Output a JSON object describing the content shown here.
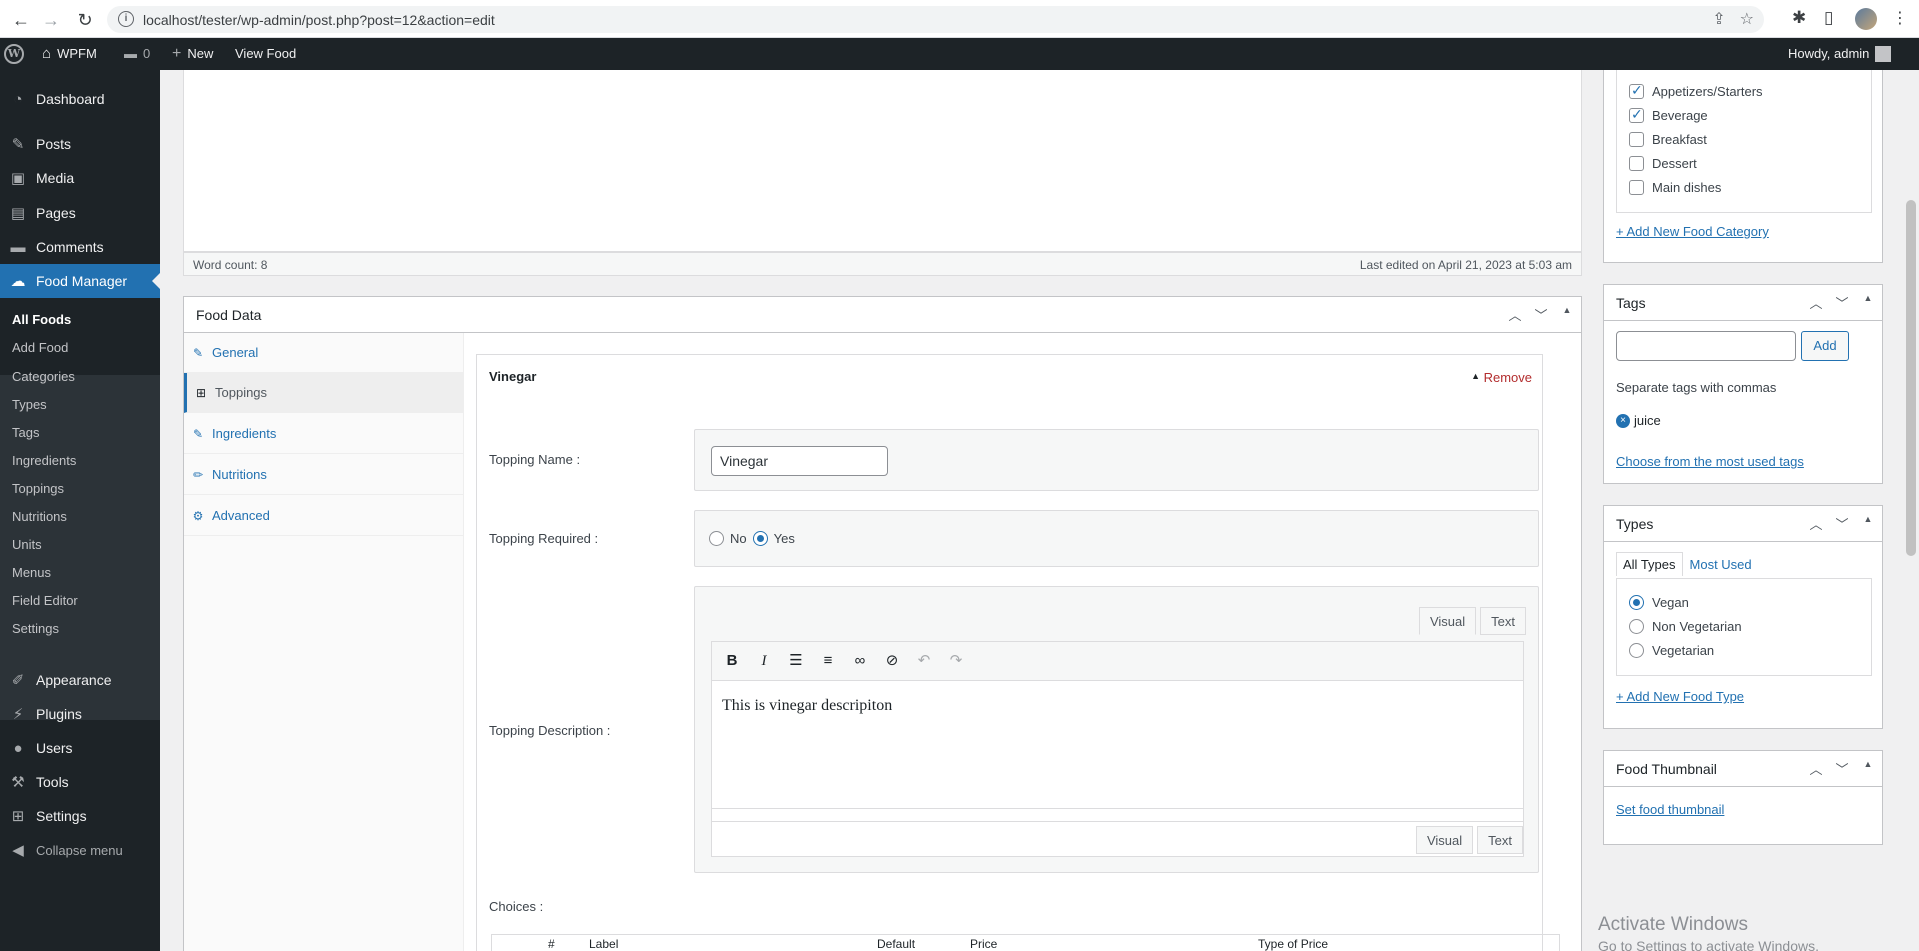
{
  "browser": {
    "url": "localhost/tester/wp-admin/post.php?post=12&action=edit"
  },
  "adminbar": {
    "site_name": "WPFM",
    "comments_count": "0",
    "new_label": "New",
    "view_label": "View Food",
    "howdy": "Howdy, admin"
  },
  "sidebar": {
    "items": [
      {
        "label": "Dashboard",
        "icon": "dashboard-icon"
      },
      {
        "label": "Posts",
        "icon": "pin-icon"
      },
      {
        "label": "Media",
        "icon": "media-icon"
      },
      {
        "label": "Pages",
        "icon": "pages-icon"
      },
      {
        "label": "Comments",
        "icon": "comment-icon"
      },
      {
        "label": "Food Manager",
        "icon": "food-manager-icon"
      },
      {
        "label": "Appearance",
        "icon": "brush-icon"
      },
      {
        "label": "Plugins",
        "icon": "plugin-icon"
      },
      {
        "label": "Users",
        "icon": "user-icon"
      },
      {
        "label": "Tools",
        "icon": "wrench-icon"
      },
      {
        "label": "Settings",
        "icon": "settings-icon"
      },
      {
        "label": "Collapse menu",
        "icon": "collapse-icon"
      }
    ],
    "submenu": [
      "All Foods",
      "Add Food",
      "Categories",
      "Types",
      "Tags",
      "Ingredients",
      "Toppings",
      "Nutritions",
      "Units",
      "Menus",
      "Field Editor",
      "Settings"
    ]
  },
  "editor": {
    "word_count": "Word count: 8",
    "last_edited": "Last edited on April 21, 2023 at 5:03 am"
  },
  "food_data": {
    "title": "Food Data",
    "tabs": [
      "General",
      "Toppings",
      "Ingredients",
      "Nutritions",
      "Advanced"
    ],
    "topping": {
      "title": "Vinegar",
      "remove_label": "Remove",
      "name_label": "Topping Name :",
      "name_value": "Vinegar",
      "required_label": "Topping Required :",
      "required_no": "No",
      "required_yes": "Yes",
      "required_selected": "Yes",
      "description_label": "Topping Description :",
      "visual_tab": "Visual",
      "text_tab": "Text",
      "description_value": "This is vinegar descripiton",
      "choices_label": "Choices :",
      "choices_columns": [
        "#",
        "Label",
        "Default",
        "Price",
        "Type of Price"
      ]
    }
  },
  "categories": {
    "items": [
      {
        "label": "Appetizers/Starters",
        "checked": true
      },
      {
        "label": "Beverage",
        "checked": true
      },
      {
        "label": "Breakfast",
        "checked": false
      },
      {
        "label": "Dessert",
        "checked": false
      },
      {
        "label": "Main dishes",
        "checked": false
      }
    ],
    "add_link": "+ Add New Food Category"
  },
  "tags": {
    "title": "Tags",
    "add_button": "Add",
    "hint": "Separate tags with commas",
    "tag": "juice",
    "most_used_link": "Choose from the most used tags"
  },
  "types": {
    "title": "Types",
    "tab_all": "All Types",
    "tab_most": "Most Used",
    "items": [
      {
        "label": "Vegan",
        "selected": true
      },
      {
        "label": "Non Vegetarian",
        "selected": false
      },
      {
        "label": "Vegetarian",
        "selected": false
      }
    ],
    "add_link": "+ Add New Food Type"
  },
  "thumbnail": {
    "title": "Food Thumbnail",
    "set_link": "Set food thumbnail"
  },
  "watermark": {
    "line1": "Activate Windows",
    "line2": "Go to Settings to activate Windows."
  }
}
